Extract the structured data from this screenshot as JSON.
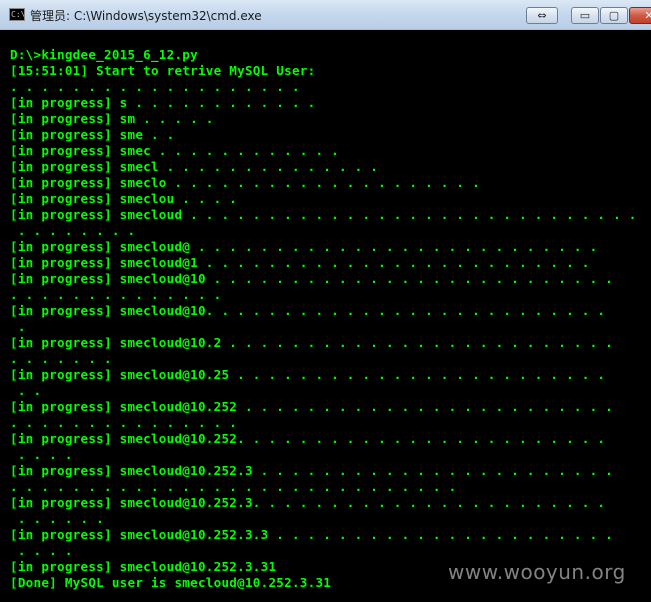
{
  "window": {
    "title": "管理员: C:\\Windows\\system32\\cmd.exe",
    "icon": "cmd-window-icon",
    "controls": {
      "special": "⇔",
      "minimize": "▭",
      "maximize": "▢",
      "close": "✕"
    }
  },
  "console": {
    "text_color": "#00ff00",
    "background": "#000000",
    "lines": [
      "D:\\>kingdee_2015_6_12.py",
      "[15:51:01] Start to retrive MySQL User:",
      ". . . . . . . . . . . . . . . . . . .",
      "[in progress] s . . . . . . . . . . . .",
      "[in progress] sm . . . . .",
      "[in progress] sme . .",
      "[in progress] smec . . . . . . . . . . . .",
      "[in progress] smecl . . . . . . . . . . . . . .",
      "[in progress] smeclo . . . . . . . . . . . . . . . . . . . .",
      "[in progress] smeclou . . . .",
      "[in progress] smecloud . . . . . . . . . . . . . . . . . . . . . . . . . . . . .",
      " . . . . . . . .",
      "[in progress] smecloud@ . . . . . . . . . . . . . . . . . . . . . . . . . .",
      "[in progress] smecloud@1 . . . . . . . . . . . . . . . . . . . . . . . . .",
      "[in progress] smecloud@10 . . . . . . . . . . . . . . . . . . . . . . . . . .",
      ". . . . . . . . . . . . . .",
      "[in progress] smecloud@10. . . . . . . . . . . . . . . . . . . . . . . . . .",
      " .",
      "[in progress] smecloud@10.2 . . . . . . . . . . . . . . . . . . . . . . . . .",
      ". . . . . . .",
      "[in progress] smecloud@10.25 . . . . . . . . . . . . . . . . . . . . . . . .",
      " . .",
      "[in progress] smecloud@10.252 . . . . . . . . . . . . . . . . . . . . . . . .",
      ". . . . . . . . . . . . . . .",
      "[in progress] smecloud@10.252. . . . . . . . . . . . . . . . . . . . . . . .",
      " . . . .",
      "[in progress] smecloud@10.252.3 . . . . . . . . . . . . . . . . . . . . . . .",
      ". . . . . . . . . . . . . . . . . . . . . . . . . . . . .",
      "[in progress] smecloud@10.252.3. . . . . . . . . . . . . . . . . . . . . . .",
      " . . . . . .",
      "[in progress] smecloud@10.252.3.3 . . . . . . . . . . . . . . . . . . . . . .",
      " . . . .",
      "[in progress] smecloud@10.252.3.31",
      "[Done] MySQL user is smecloud@10.252.3.31"
    ]
  },
  "watermark": "www.wooyun.org"
}
